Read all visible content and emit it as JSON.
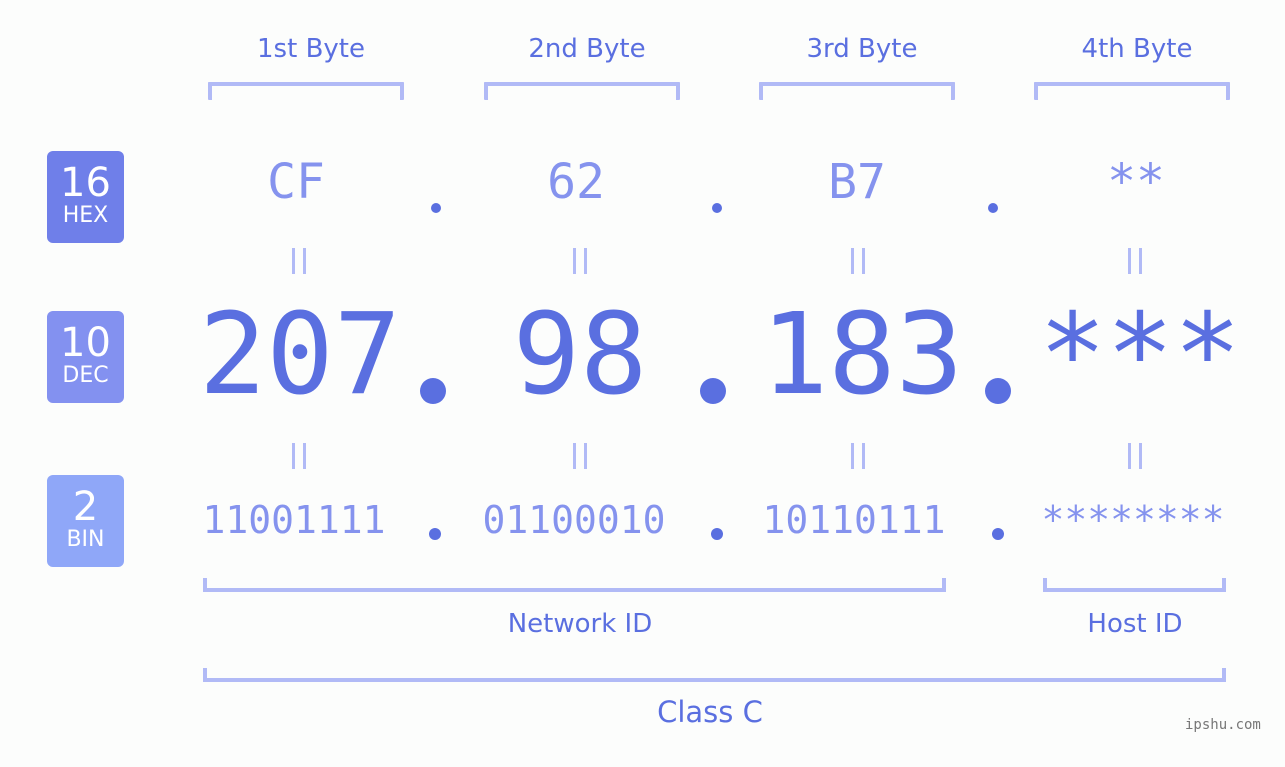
{
  "headers": [
    "1st Byte",
    "2nd Byte",
    "3rd Byte",
    "4th Byte"
  ],
  "badges": [
    {
      "num": "16",
      "label": "HEX",
      "color": "#6f7fe9"
    },
    {
      "num": "10",
      "label": "DEC",
      "color": "#8391f0"
    },
    {
      "num": "2",
      "label": "BIN",
      "color": "#8fa7f8"
    }
  ],
  "hex": [
    "CF",
    "62",
    "B7",
    "**"
  ],
  "dec": [
    "207",
    "98",
    "183",
    "***"
  ],
  "bin": [
    "11001111",
    "01100010",
    "10110111",
    "********"
  ],
  "network_label": "Network ID",
  "host_label": "Host ID",
  "class_label": "Class C",
  "watermark": "ipshu.com"
}
